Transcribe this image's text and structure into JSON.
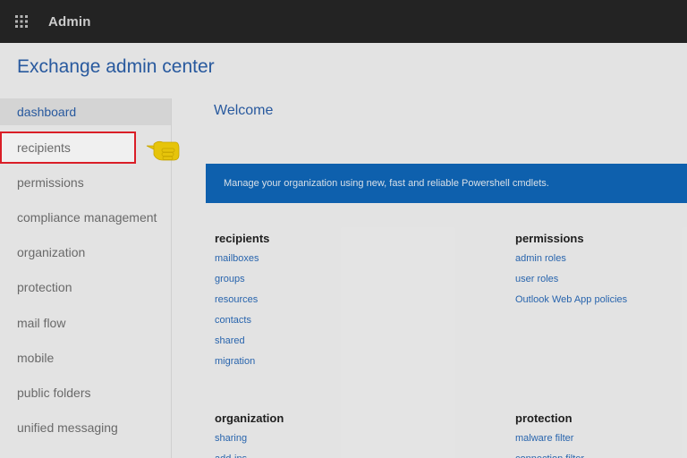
{
  "topbar": {
    "app_name": "Admin"
  },
  "page": {
    "title": "Exchange admin center"
  },
  "nav": {
    "items": [
      {
        "label": "dashboard"
      },
      {
        "label": "recipients"
      },
      {
        "label": "permissions"
      },
      {
        "label": "compliance management"
      },
      {
        "label": "organization"
      },
      {
        "label": "protection"
      },
      {
        "label": "mail flow"
      },
      {
        "label": "mobile"
      },
      {
        "label": "public folders"
      },
      {
        "label": "unified messaging"
      }
    ]
  },
  "main": {
    "welcome": "Welcome",
    "banner": "Manage your organization using new, fast and reliable Powershell cmdlets.",
    "sections": [
      {
        "title": "recipients",
        "links": [
          "mailboxes",
          "groups",
          "resources",
          "contacts",
          "shared",
          "migration"
        ]
      },
      {
        "title": "permissions",
        "links": [
          "admin roles",
          "user roles",
          "Outlook Web App policies"
        ]
      },
      {
        "title": "organization",
        "links": [
          "sharing",
          "add-ins"
        ]
      },
      {
        "title": "protection",
        "links": [
          "malware filter",
          "connection filter"
        ]
      }
    ]
  },
  "colors": {
    "accent": "#2b5fa8",
    "banner": "#0f67b8",
    "highlight_border": "#e8202a",
    "pointer": "#f5d10b"
  },
  "icons": {
    "app_launcher": "waffle-icon",
    "pointer": "pointing-hand-icon"
  }
}
